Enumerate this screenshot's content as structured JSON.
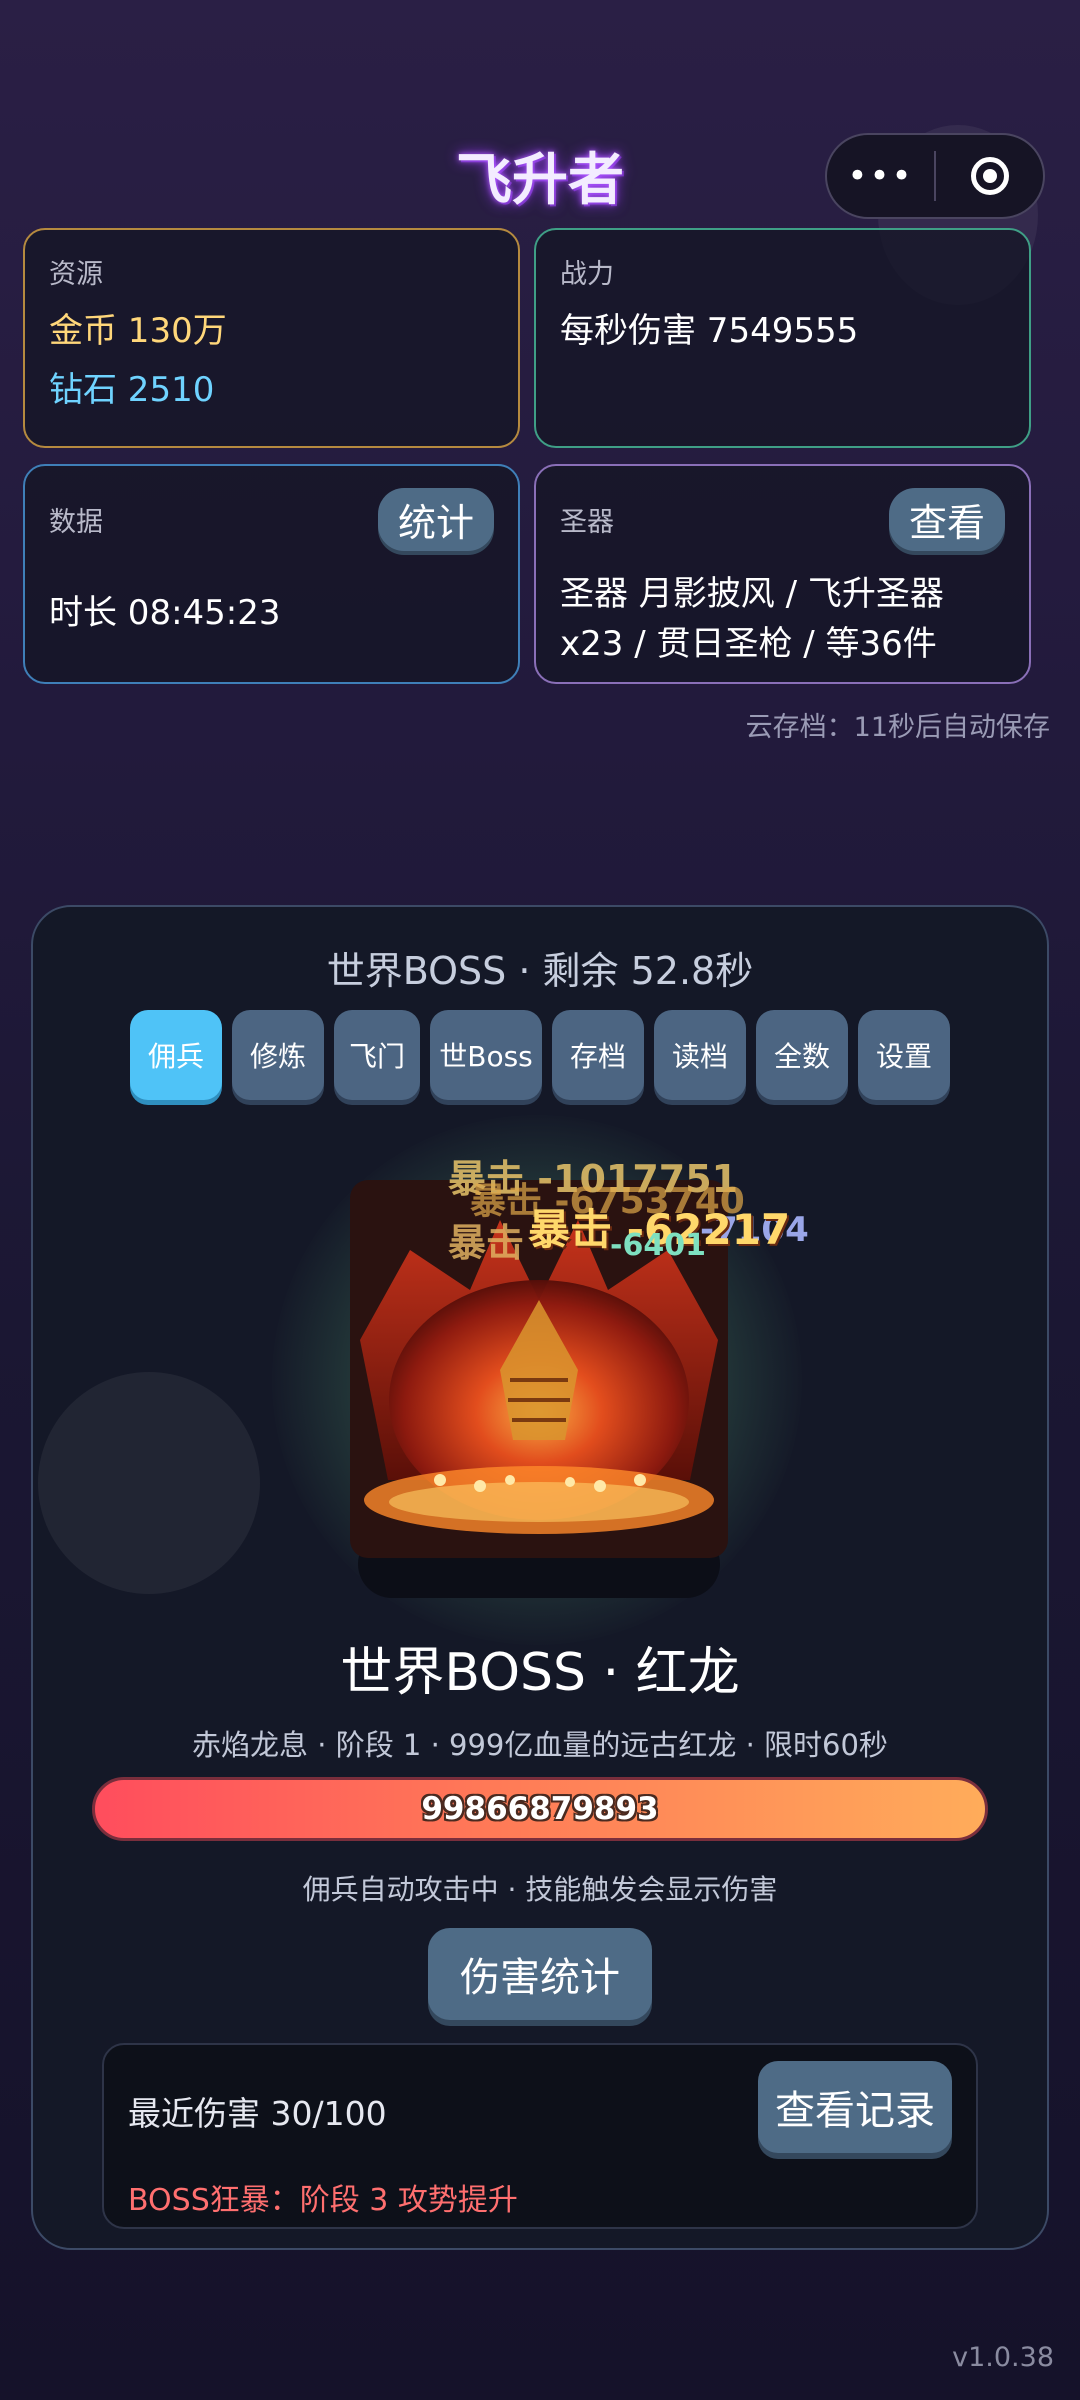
{
  "app": {
    "title": "飞升者",
    "version": "v1.0.38"
  },
  "capsule": {
    "more_glyph": "•••"
  },
  "resources": {
    "label": "资源",
    "gold": "金币 130万",
    "diamond": "钻石 2510"
  },
  "power": {
    "label": "战力",
    "dps": "每秒伤害 7549555"
  },
  "stats": {
    "label": "数据",
    "button": "统计",
    "duration": "时长 08:45:23"
  },
  "artifacts": {
    "label": "圣器",
    "button": "查看",
    "summary": "圣器 月影披风 / 飞升圣器x23 / 贯日圣枪 / 等36件"
  },
  "cloud_save": "云存档：11秒后自动保存",
  "boss_panel": {
    "header": "世界BOSS · 剩余 52.8秒",
    "tabs": [
      {
        "label": "佣兵",
        "active": true
      },
      {
        "label": "修炼",
        "active": false
      },
      {
        "label": "飞门",
        "active": false
      },
      {
        "label": "世Boss",
        "active": false
      },
      {
        "label": "存档",
        "active": false
      },
      {
        "label": "读档",
        "active": false
      },
      {
        "label": "全数",
        "active": false
      },
      {
        "label": "设置",
        "active": false
      }
    ],
    "damage_popups": [
      {
        "text": "暴击 -1017751",
        "color": "#e8c46a"
      },
      {
        "text": "暴击 -6753740",
        "color": "#e0a84a"
      },
      {
        "text": "-7104",
        "color": "#9aa6e8"
      },
      {
        "text": "暴击 -62217",
        "color": "#ffd86b"
      },
      {
        "text": "暴击",
        "color": "#e0b060"
      },
      {
        "text": "-6401",
        "color": "#7ee0c0"
      }
    ],
    "boss_name": "世界BOSS · 红龙",
    "boss_desc": "赤焰龙息 · 阶段 1 · 999亿血量的远古红龙 · 限时60秒",
    "hp_value": "99866879893",
    "hp_fraction": 0.998,
    "auto_note": "佣兵自动攻击中 · 技能触发会显示伤害",
    "damage_stats_button": "伤害统计",
    "recent_damage": "最近伤害 30/100",
    "view_records_button": "查看记录",
    "rage_notice": "BOSS狂暴：阶段 3 攻势提升"
  }
}
